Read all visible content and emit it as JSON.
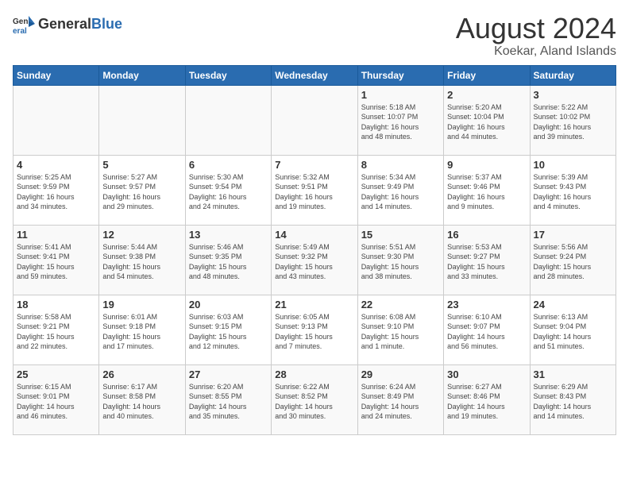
{
  "logo": {
    "general": "General",
    "blue": "Blue"
  },
  "title": "August 2024",
  "subtitle": "Koekar, Aland Islands",
  "weekdays": [
    "Sunday",
    "Monday",
    "Tuesday",
    "Wednesday",
    "Thursday",
    "Friday",
    "Saturday"
  ],
  "weeks": [
    [
      {
        "day": "",
        "info": ""
      },
      {
        "day": "",
        "info": ""
      },
      {
        "day": "",
        "info": ""
      },
      {
        "day": "",
        "info": ""
      },
      {
        "day": "1",
        "info": "Sunrise: 5:18 AM\nSunset: 10:07 PM\nDaylight: 16 hours\nand 48 minutes."
      },
      {
        "day": "2",
        "info": "Sunrise: 5:20 AM\nSunset: 10:04 PM\nDaylight: 16 hours\nand 44 minutes."
      },
      {
        "day": "3",
        "info": "Sunrise: 5:22 AM\nSunset: 10:02 PM\nDaylight: 16 hours\nand 39 minutes."
      }
    ],
    [
      {
        "day": "4",
        "info": "Sunrise: 5:25 AM\nSunset: 9:59 PM\nDaylight: 16 hours\nand 34 minutes."
      },
      {
        "day": "5",
        "info": "Sunrise: 5:27 AM\nSunset: 9:57 PM\nDaylight: 16 hours\nand 29 minutes."
      },
      {
        "day": "6",
        "info": "Sunrise: 5:30 AM\nSunset: 9:54 PM\nDaylight: 16 hours\nand 24 minutes."
      },
      {
        "day": "7",
        "info": "Sunrise: 5:32 AM\nSunset: 9:51 PM\nDaylight: 16 hours\nand 19 minutes."
      },
      {
        "day": "8",
        "info": "Sunrise: 5:34 AM\nSunset: 9:49 PM\nDaylight: 16 hours\nand 14 minutes."
      },
      {
        "day": "9",
        "info": "Sunrise: 5:37 AM\nSunset: 9:46 PM\nDaylight: 16 hours\nand 9 minutes."
      },
      {
        "day": "10",
        "info": "Sunrise: 5:39 AM\nSunset: 9:43 PM\nDaylight: 16 hours\nand 4 minutes."
      }
    ],
    [
      {
        "day": "11",
        "info": "Sunrise: 5:41 AM\nSunset: 9:41 PM\nDaylight: 15 hours\nand 59 minutes."
      },
      {
        "day": "12",
        "info": "Sunrise: 5:44 AM\nSunset: 9:38 PM\nDaylight: 15 hours\nand 54 minutes."
      },
      {
        "day": "13",
        "info": "Sunrise: 5:46 AM\nSunset: 9:35 PM\nDaylight: 15 hours\nand 48 minutes."
      },
      {
        "day": "14",
        "info": "Sunrise: 5:49 AM\nSunset: 9:32 PM\nDaylight: 15 hours\nand 43 minutes."
      },
      {
        "day": "15",
        "info": "Sunrise: 5:51 AM\nSunset: 9:30 PM\nDaylight: 15 hours\nand 38 minutes."
      },
      {
        "day": "16",
        "info": "Sunrise: 5:53 AM\nSunset: 9:27 PM\nDaylight: 15 hours\nand 33 minutes."
      },
      {
        "day": "17",
        "info": "Sunrise: 5:56 AM\nSunset: 9:24 PM\nDaylight: 15 hours\nand 28 minutes."
      }
    ],
    [
      {
        "day": "18",
        "info": "Sunrise: 5:58 AM\nSunset: 9:21 PM\nDaylight: 15 hours\nand 22 minutes."
      },
      {
        "day": "19",
        "info": "Sunrise: 6:01 AM\nSunset: 9:18 PM\nDaylight: 15 hours\nand 17 minutes."
      },
      {
        "day": "20",
        "info": "Sunrise: 6:03 AM\nSunset: 9:15 PM\nDaylight: 15 hours\nand 12 minutes."
      },
      {
        "day": "21",
        "info": "Sunrise: 6:05 AM\nSunset: 9:13 PM\nDaylight: 15 hours\nand 7 minutes."
      },
      {
        "day": "22",
        "info": "Sunrise: 6:08 AM\nSunset: 9:10 PM\nDaylight: 15 hours\nand 1 minute."
      },
      {
        "day": "23",
        "info": "Sunrise: 6:10 AM\nSunset: 9:07 PM\nDaylight: 14 hours\nand 56 minutes."
      },
      {
        "day": "24",
        "info": "Sunrise: 6:13 AM\nSunset: 9:04 PM\nDaylight: 14 hours\nand 51 minutes."
      }
    ],
    [
      {
        "day": "25",
        "info": "Sunrise: 6:15 AM\nSunset: 9:01 PM\nDaylight: 14 hours\nand 46 minutes."
      },
      {
        "day": "26",
        "info": "Sunrise: 6:17 AM\nSunset: 8:58 PM\nDaylight: 14 hours\nand 40 minutes."
      },
      {
        "day": "27",
        "info": "Sunrise: 6:20 AM\nSunset: 8:55 PM\nDaylight: 14 hours\nand 35 minutes."
      },
      {
        "day": "28",
        "info": "Sunrise: 6:22 AM\nSunset: 8:52 PM\nDaylight: 14 hours\nand 30 minutes."
      },
      {
        "day": "29",
        "info": "Sunrise: 6:24 AM\nSunset: 8:49 PM\nDaylight: 14 hours\nand 24 minutes."
      },
      {
        "day": "30",
        "info": "Sunrise: 6:27 AM\nSunset: 8:46 PM\nDaylight: 14 hours\nand 19 minutes."
      },
      {
        "day": "31",
        "info": "Sunrise: 6:29 AM\nSunset: 8:43 PM\nDaylight: 14 hours\nand 14 minutes."
      }
    ]
  ]
}
